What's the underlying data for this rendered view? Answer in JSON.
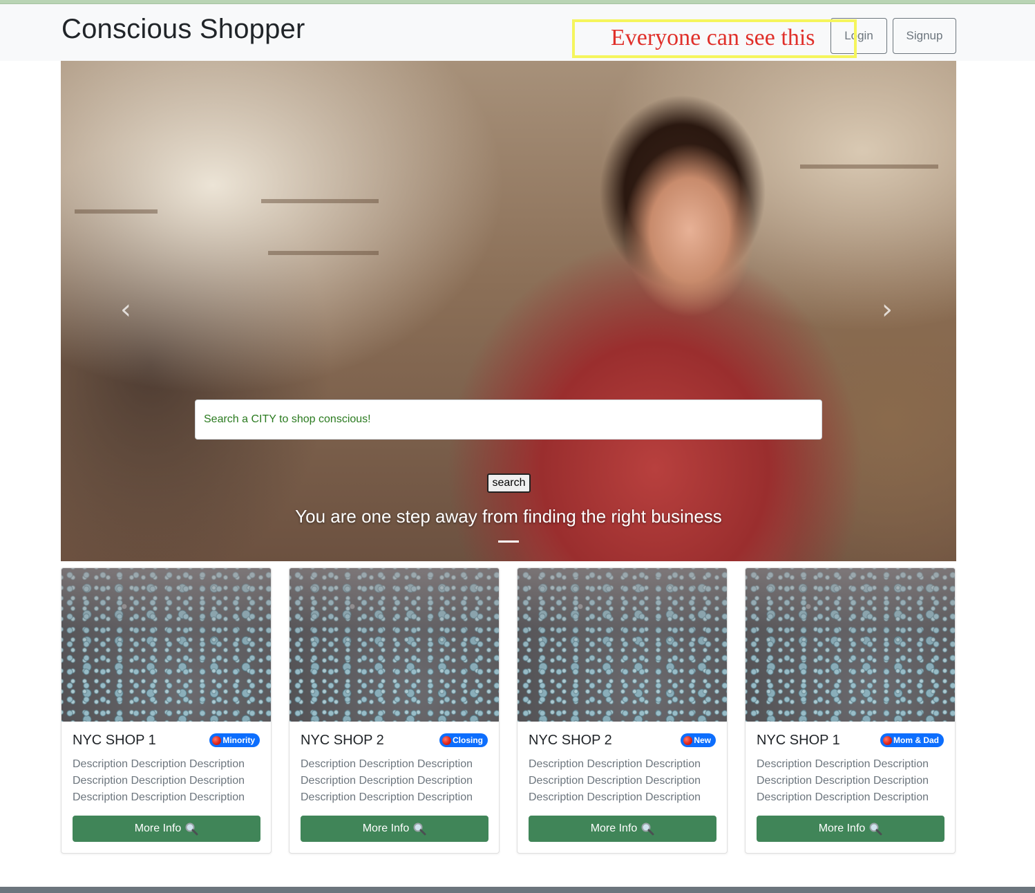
{
  "header": {
    "brand": "Conscious Shopper",
    "annotation": "Everyone can see this",
    "login_label": "Login",
    "signup_label": "Signup"
  },
  "hero": {
    "search_placeholder": "Search a CITY to shop conscious!",
    "search_button_label": "search",
    "caption": "You are one step away from finding the right business",
    "prev_icon": "chevron-left-icon",
    "next_icon": "chevron-right-icon"
  },
  "cards": [
    {
      "title": "NYC SHOP 1",
      "badge": "Minority",
      "description": "Description Description Description Description Description Description Description Description Description",
      "button_label": "More Info"
    },
    {
      "title": "NYC SHOP 2",
      "badge": "Closing",
      "description": "Description Description Description Description Description Description Description Description Description",
      "button_label": "More Info"
    },
    {
      "title": "NYC SHOP 2",
      "badge": "New",
      "description": "Description Description Description Description Description Description Description Description Description",
      "button_label": "More Info"
    },
    {
      "title": "NYC SHOP 1",
      "badge": "Mom & Dad",
      "description": "Description Description Description Description Description Description Description Description Description",
      "button_label": "More Info"
    }
  ],
  "colors": {
    "accent_green": "#408558",
    "badge_blue": "#0d6efd",
    "annotation_red": "#e0302a",
    "annotation_border": "#f5f55c"
  },
  "icons": [
    "chevron-left-icon",
    "chevron-right-icon",
    "magnifier-icon",
    "red-circle-icon"
  ]
}
